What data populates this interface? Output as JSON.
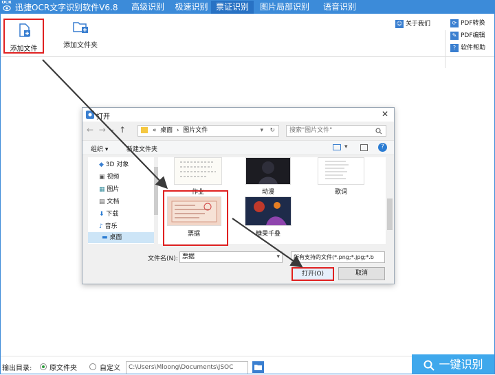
{
  "app": {
    "logo_text": "OCR",
    "title": "迅捷OCR文字识别软件V6.8"
  },
  "nav_tabs": [
    {
      "label": "高级识别"
    },
    {
      "label": "极速识别"
    },
    {
      "label": "票证识别",
      "active": true
    },
    {
      "label": "图片局部识别"
    },
    {
      "label": "语音识别"
    }
  ],
  "toolbar": {
    "add_file": "添加文件",
    "add_folder": "添加文件夹",
    "about": "关于我们",
    "pdf_convert": "PDF转换",
    "pdf_edit": "PDF编辑",
    "help": "软件帮助"
  },
  "dialog": {
    "title": "打开",
    "breadcrumb": [
      "«",
      "桌面",
      "›",
      "图片文件"
    ],
    "search_placeholder": "搜索\"图片文件\"",
    "organize": "组织 ▾",
    "new_folder": "新建文件夹",
    "sidebar": [
      {
        "label": "3D 对象",
        "icon": "3d-cube-icon"
      },
      {
        "label": "视频",
        "icon": "video-icon"
      },
      {
        "label": "图片",
        "icon": "picture-icon"
      },
      {
        "label": "文档",
        "icon": "document-icon"
      },
      {
        "label": "下载",
        "icon": "download-icon"
      },
      {
        "label": "音乐",
        "icon": "music-icon"
      },
      {
        "label": "桌面",
        "icon": "desktop-icon",
        "active": true
      }
    ],
    "files": [
      "作业",
      "动漫",
      "歌词",
      "票据",
      "糖果千叠"
    ],
    "filename_label": "文件名(N):",
    "filename_value": "票据",
    "filetype": "所有支持的文件(*.png;*.jpg;*.b",
    "open_button": "打开(O)",
    "cancel_button": "取消"
  },
  "bottom": {
    "output_label": "输出目录:",
    "option_source": "原文件夹",
    "option_custom": "自定义",
    "path": "C:\\Users\\Mloong\\Documents\\JSOC",
    "recognize_button": "一键识别"
  },
  "colors": {
    "brand": "#3c8bd9",
    "highlight": "#e02020",
    "action": "#3fa8ec"
  }
}
